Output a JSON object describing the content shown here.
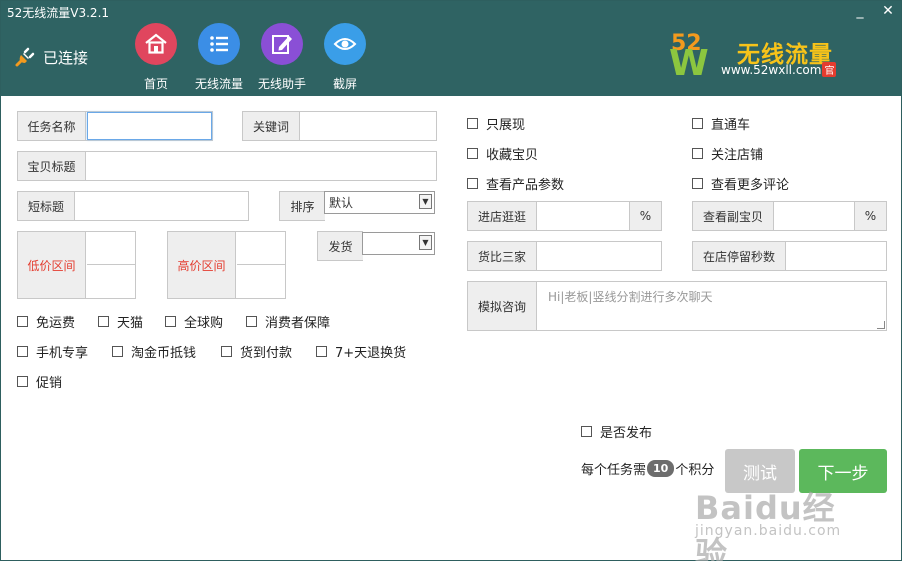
{
  "window": {
    "title": "52无线流量V3.2.1",
    "minimize": "_",
    "close": "✕"
  },
  "header": {
    "status": "已连接",
    "nav": [
      {
        "label": "首页",
        "icon": "home-icon",
        "color": "#e0465e"
      },
      {
        "label": "无线流量",
        "icon": "list-icon",
        "color": "#3b8ee6"
      },
      {
        "label": "无线助手",
        "icon": "edit-icon",
        "color": "#8a4fd6"
      },
      {
        "label": "截屏",
        "icon": "eye-icon",
        "color": "#3a9ee8"
      }
    ],
    "logo": {
      "num": "52",
      "letter": "W",
      "name": "无线流量",
      "url": "www.52wxll.com",
      "badge": "官"
    }
  },
  "form": {
    "task_name": {
      "label": "任务名称",
      "value": ""
    },
    "keyword": {
      "label": "关键词",
      "value": ""
    },
    "item_title": {
      "label": "宝贝标题",
      "value": ""
    },
    "short_title": {
      "label": "短标题",
      "value": ""
    },
    "sort": {
      "label": "排序",
      "value": "默认"
    },
    "ship": {
      "label": "发货",
      "value": ""
    },
    "low_price": {
      "label": "低价区间"
    },
    "high_price": {
      "label": "高价区间"
    },
    "filters": [
      {
        "label": "免运费",
        "checked": false
      },
      {
        "label": "天猫",
        "checked": false
      },
      {
        "label": "全球购",
        "checked": false
      },
      {
        "label": "消费者保障",
        "checked": false
      },
      {
        "label": "手机专享",
        "checked": false
      },
      {
        "label": "淘金币抵钱",
        "checked": false
      },
      {
        "label": "货到付款",
        "checked": false
      },
      {
        "label": "7+天退换货",
        "checked": false
      },
      {
        "label": "促销",
        "checked": false
      }
    ]
  },
  "options": {
    "checks": [
      {
        "label": "只展现",
        "checked": false
      },
      {
        "label": "直通车",
        "checked": false
      },
      {
        "label": "收藏宝贝",
        "checked": false
      },
      {
        "label": "关注店铺",
        "checked": false
      },
      {
        "label": "查看产品参数",
        "checked": false
      },
      {
        "label": "查看更多评论",
        "checked": false
      }
    ],
    "enter_shop": {
      "label": "进店逛逛",
      "unit": "%"
    },
    "view_sub": {
      "label": "查看副宝贝",
      "unit": "%"
    },
    "compare": {
      "label": "货比三家"
    },
    "stay_seconds": {
      "label": "在店停留秒数"
    },
    "chat": {
      "label": "模拟咨询",
      "placeholder": "Hi|老板|竖线分割进行多次聊天"
    }
  },
  "footer": {
    "publish": "是否发布",
    "points_prefix": "每个任务需",
    "points_value": "10",
    "points_suffix": "个积分",
    "test_btn": "测试",
    "next_btn": "下一步"
  },
  "watermark": {
    "big": "Baidu经验",
    "small": "jingyan.baidu.com"
  }
}
